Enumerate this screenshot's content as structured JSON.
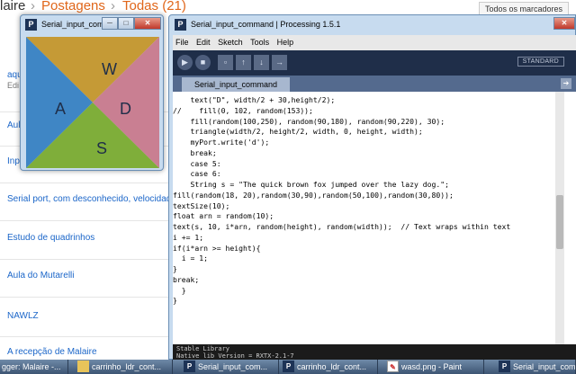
{
  "blogger": {
    "breadcrumb": {
      "part1": "laire",
      "sep": "›",
      "part2": "Postagens",
      "part3": "Todas (21)"
    },
    "markers_button": "Todos os marcadores",
    "posts": [
      {
        "title": "aqu",
        "sub": "Edi"
      },
      {
        "title": "Aul"
      },
      {
        "title": "Inp"
      },
      {
        "title": "Serial port, com desconhecido, velocidad"
      },
      {
        "title": "Estudo de quadrinhos"
      },
      {
        "title": "Aula do Mutarelli"
      },
      {
        "title": "NAWLZ"
      },
      {
        "title": "A recepção de Malaire"
      }
    ],
    "right_edge_text": "1"
  },
  "sketch_window": {
    "title": "Serial_input_comm...",
    "letters": {
      "w": "W",
      "a": "A",
      "d": "D",
      "s": "S"
    },
    "colors": {
      "top": "#c59a36",
      "left": "#3f86c5",
      "right": "#c97f92",
      "bottom": "#7fae3a"
    },
    "buttons": {
      "minimize": "─",
      "maximize": "□",
      "close": "✕"
    }
  },
  "ide": {
    "title": "Serial_input_command | Processing 1.5.1",
    "menu": [
      "File",
      "Edit",
      "Sketch",
      "Tools",
      "Help"
    ],
    "toolbar_buttons": [
      {
        "name": "run-button",
        "icon": "▶"
      },
      {
        "name": "stop-button",
        "icon": "■"
      },
      {
        "name": "new-button",
        "icon": "▫"
      },
      {
        "name": "open-button",
        "icon": "↑"
      },
      {
        "name": "save-button",
        "icon": "↓"
      },
      {
        "name": "export-button",
        "icon": "→"
      }
    ],
    "mode": "STANDARD",
    "tab": "Serial_input_command",
    "code_lines": [
      "    text(\"D\", width/2 + 30,height/2);",
      "//    fill(0, 102, random(153));",
      "    fill(random(100,250), random(90,180), random(90,220), 30);",
      "    triangle(width/2, height/2, width, 0, height, width);",
      "    myPort.write('d');",
      "    break;",
      "    case 5:",
      "    case 6:",
      "    String s = \"The quick brown fox jumped over the lazy dog.\";",
      "fill(random(18, 20),random(30,90),random(50,100),random(30,80));",
      "textSize(10);",
      "float arn = random(10);",
      "text(s, 10, i*arn, random(height), random(width));  // Text wraps within text",
      "i += 1;",
      "if(i*arn >= height){",
      "  i = 1;",
      "}",
      "break;",
      "  }",
      "}"
    ],
    "console_lines": [
      "Stable Library",
      "Native lib Version = RXTX-2.1-7"
    ]
  },
  "taskbar": [
    {
      "label": "gger: Malaire -...",
      "icon": "none"
    },
    {
      "label": "carrinho_ldr_cont...",
      "icon": "folder"
    },
    {
      "label": "Serial_input_com...",
      "icon": "p5"
    },
    {
      "label": "carrinho_ldr_cont...",
      "icon": "p5"
    },
    {
      "label": "wasd.png - Paint",
      "icon": "paint"
    },
    {
      "label": "Serial_input_com...",
      "icon": "p5"
    }
  ]
}
